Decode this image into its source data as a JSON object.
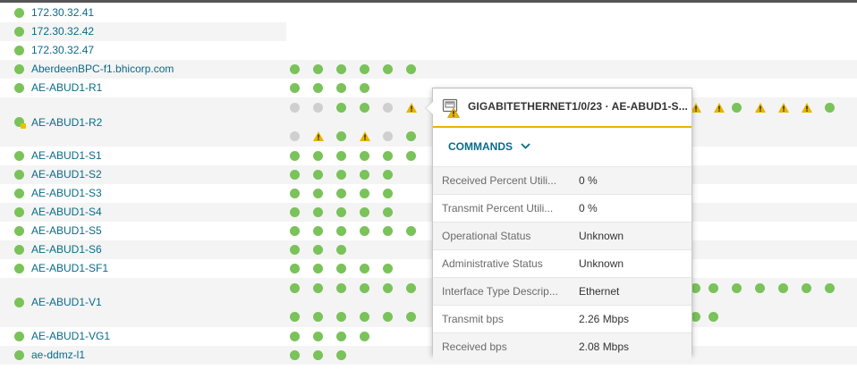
{
  "colors": {
    "status_up": "#7ac25a",
    "status_unknown": "#cfcfcf",
    "warning": "#e8b400",
    "link": "#0a6b8a"
  },
  "nodes": [
    {
      "name": "172.30.32.41",
      "status": "up"
    },
    {
      "name": "172.30.32.42",
      "status": "up"
    },
    {
      "name": "172.30.32.47",
      "status": "up"
    },
    {
      "name": "AberdeenBPC-f1.bhicorp.com",
      "status": "up"
    },
    {
      "name": "AE-ABUD1-R1",
      "status": "up"
    },
    {
      "name": "AE-ABUD1-R2",
      "status": "up-warning"
    },
    {
      "name": "AE-ABUD1-S1",
      "status": "up"
    },
    {
      "name": "AE-ABUD1-S2",
      "status": "up"
    },
    {
      "name": "AE-ABUD1-S3",
      "status": "up"
    },
    {
      "name": "AE-ABUD1-S4",
      "status": "up"
    },
    {
      "name": "AE-ABUD1-S5",
      "status": "up"
    },
    {
      "name": "AE-ABUD1-S6",
      "status": "up"
    },
    {
      "name": "AE-ABUD1-SF1",
      "status": "up"
    },
    {
      "name": "AE-ABUD1-V1",
      "status": "up"
    },
    {
      "name": "AE-ABUD1-VG1",
      "status": "up"
    },
    {
      "name": "ae-ddmz-l1",
      "status": "up"
    }
  ],
  "tooltip": {
    "icon": "network-interface-warning-icon",
    "title": "GIGABITETHERNET1/0/23 · AE-ABUD1-S...",
    "commands_label": "COMMANDS",
    "properties": [
      {
        "label": "Received Percent Utili...",
        "value": "0 %"
      },
      {
        "label": "Transmit Percent Utili...",
        "value": "0 %"
      },
      {
        "label": "Operational Status",
        "value": "Unknown"
      },
      {
        "label": "Administrative Status",
        "value": "Unknown"
      },
      {
        "label": "Interface Type Descrip...",
        "value": "Ethernet"
      },
      {
        "label": "Transmit bps",
        "value": "2.26 Mbps"
      },
      {
        "label": "Received bps",
        "value": "2.08 Mbps"
      }
    ]
  }
}
